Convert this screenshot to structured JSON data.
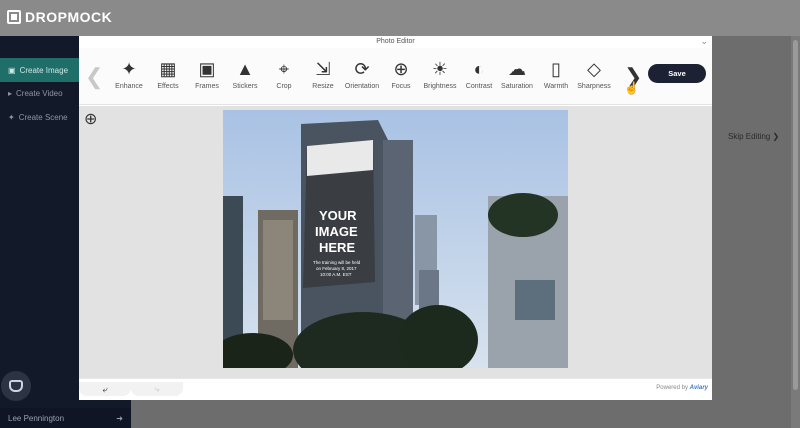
{
  "app": {
    "logo_text": "DROPMOCK"
  },
  "sidebar": {
    "items": [
      {
        "label": "Create Image",
        "icon": "camera-icon"
      },
      {
        "label": "Create Video",
        "icon": "video-icon"
      },
      {
        "label": "Create Scene",
        "icon": "wand-icon"
      }
    ],
    "user_name": "Lee Pennington"
  },
  "skip": {
    "label": "Skip Editing"
  },
  "editor": {
    "title": "Photo Editor",
    "tools": [
      {
        "label": "Enhance",
        "icon": "magic-wand-icon"
      },
      {
        "label": "Effects",
        "icon": "film-icon"
      },
      {
        "label": "Frames",
        "icon": "frame-icon"
      },
      {
        "label": "Stickers",
        "icon": "hat-icon"
      },
      {
        "label": "Crop",
        "icon": "crop-icon"
      },
      {
        "label": "Resize",
        "icon": "resize-icon"
      },
      {
        "label": "Orientation",
        "icon": "rotate-icon"
      },
      {
        "label": "Focus",
        "icon": "target-icon"
      },
      {
        "label": "Brightness",
        "icon": "sun-icon"
      },
      {
        "label": "Contrast",
        "icon": "contrast-icon"
      },
      {
        "label": "Saturation",
        "icon": "droplet-icon"
      },
      {
        "label": "Warmth",
        "icon": "thermometer-icon"
      },
      {
        "label": "Sharpness",
        "icon": "diamond-icon"
      }
    ],
    "save_label": "Save",
    "powered_prefix": "Powered by",
    "powered_brand": "Aviary"
  },
  "billboard": {
    "headline_1": "YOUR",
    "headline_2": "IMAGE",
    "headline_3": "HERE",
    "line_1": "The training will be held",
    "line_2": "on February 8, 2017",
    "line_3": "10:00 A.M. EST"
  },
  "colors": {
    "accent": "#1f6e6a",
    "sidebar_bg": "#121a2a",
    "save_bg": "#1c2233"
  }
}
